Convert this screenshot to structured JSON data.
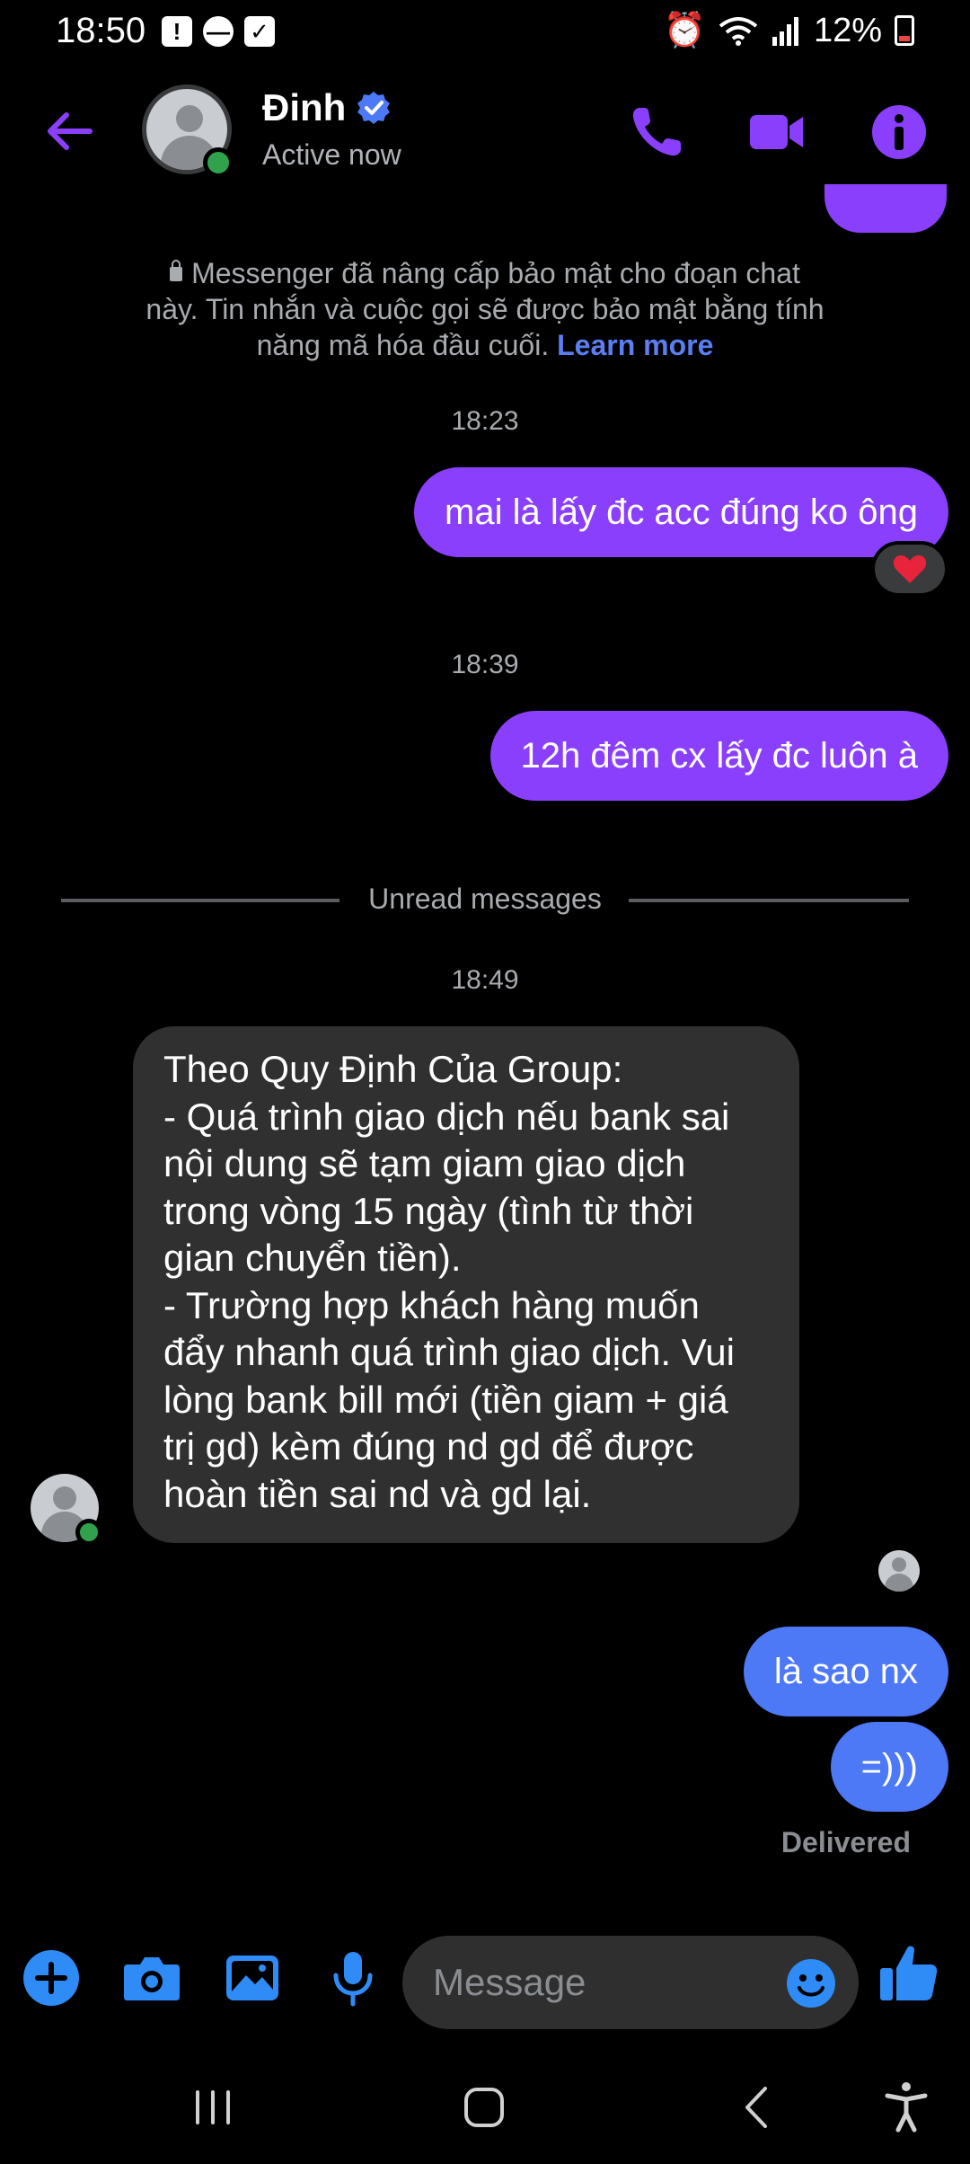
{
  "status_bar": {
    "time": "18:50",
    "battery": "12%"
  },
  "header": {
    "contact_name": "Đinh",
    "status": "Active now"
  },
  "e2ee_notice": {
    "text": "Messenger đã nâng cấp bảo mật cho đoạn chat này. Tin nhắn và cuộc gọi sẽ được bảo mật bằng tính năng mã hóa đầu cuối.",
    "link": "Learn more"
  },
  "messages": {
    "ts1": "18:23",
    "out1": "mai là lấy đc acc đúng ko ông",
    "reaction1": "❤️",
    "ts2": "18:39",
    "out2": "12h đêm cx lấy đc luôn à",
    "unread_divider": "Unread messages",
    "ts3": "18:49",
    "in1_lines": [
      "Theo Quy Định Của Group:",
      "- Quá trình giao dịch nếu bank sai",
      "nội dung sẽ tạm giam giao dịch",
      "trong vòng 15 ngày (tình từ thời",
      "gian chuyển tiền).",
      "- Trường hợp khách hàng muốn",
      "đẩy nhanh quá trình giao dịch. Vui",
      "lòng bank bill mới (tiền giam + giá",
      "trị gd) kèm đúng nd gd để được",
      "hoàn tiền sai nd và gd lại."
    ],
    "out3": "là sao nx",
    "out4": "=)))",
    "delivered": "Delivered"
  },
  "composer": {
    "placeholder": "Message"
  },
  "colors": {
    "accent_purple": "#8a3ffc",
    "bubble_blue": "#4d78f6",
    "incoming_bubble": "#303030",
    "online_green": "#31a24c",
    "link_blue": "#5b7ff3"
  },
  "icons": {
    "header": [
      "back-arrow-icon",
      "phone-icon",
      "video-camera-icon",
      "info-icon",
      "verified-badge-icon"
    ],
    "composer": [
      "plus-icon",
      "camera-icon",
      "gallery-icon",
      "microphone-icon",
      "emoji-icon",
      "thumbs-up-icon"
    ],
    "nav": [
      "recents-icon",
      "home-icon",
      "back-icon",
      "accessibility-icon"
    ]
  }
}
